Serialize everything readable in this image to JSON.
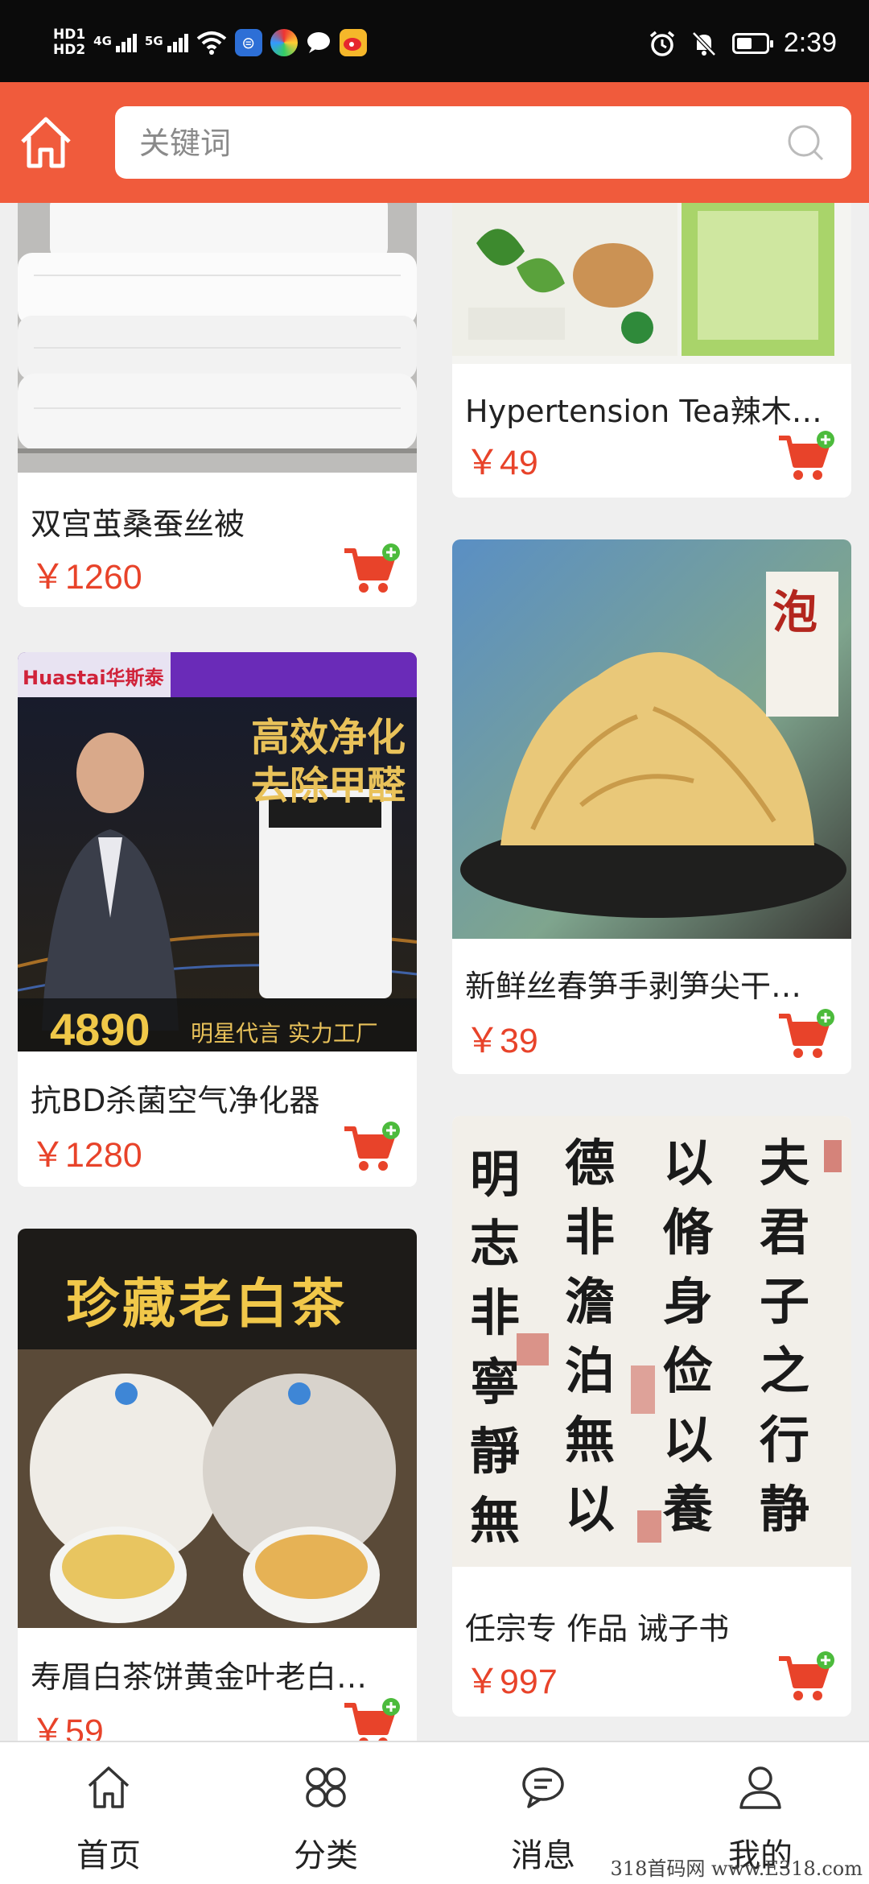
{
  "status_bar": {
    "hd1": "HD1",
    "hd2": "HD2",
    "net1": "4G",
    "net2": "5G",
    "time": "2:39"
  },
  "header": {
    "search_placeholder": "关键词"
  },
  "products": [
    {
      "title": "双宫茧桑蚕丝被",
      "price": "￥1260",
      "image": "silk-quilt"
    },
    {
      "title": "Hypertension Tea辣木…",
      "price": "￥49",
      "image": "hypertension-tea"
    },
    {
      "title": "抗BD杀菌空气净化器",
      "price": "￥1280",
      "image": "air-purifier"
    },
    {
      "title": "新鲜丝春笋手剥笋尖干…",
      "price": "￥39",
      "image": "bamboo-shoots"
    },
    {
      "title": "寿眉白茶饼黄金叶老白…",
      "price": "￥59",
      "image": "white-tea"
    },
    {
      "title": "任宗专 作品 诫子书",
      "price": "￥997",
      "image": "calligraphy"
    }
  ],
  "image_text": {
    "purifier_brand": "Huastai华斯泰",
    "purifier_headline1": "高效净化",
    "purifier_headline2": "去除甲醛",
    "purifier_price": "4890",
    "purifier_slogan": "明星代言 实力工厂",
    "tea_headline": "珍藏老白茶",
    "shoots_tag": "泡",
    "calligraphy_cols": [
      "夫君子之行静",
      "以脩身俭以養",
      "德非澹泊無以",
      "明志非寧靜無"
    ]
  },
  "bottom_nav": [
    {
      "label": "首页",
      "icon": "home-icon"
    },
    {
      "label": "分类",
      "icon": "category-icon"
    },
    {
      "label": "消息",
      "icon": "message-icon"
    },
    {
      "label": "我的",
      "icon": "user-icon"
    }
  ],
  "watermark": "318首码网 www.E318.com",
  "colors": {
    "accent": "#f05b3c",
    "price": "#e8432a",
    "cart_plus": "#4cbb3c"
  }
}
